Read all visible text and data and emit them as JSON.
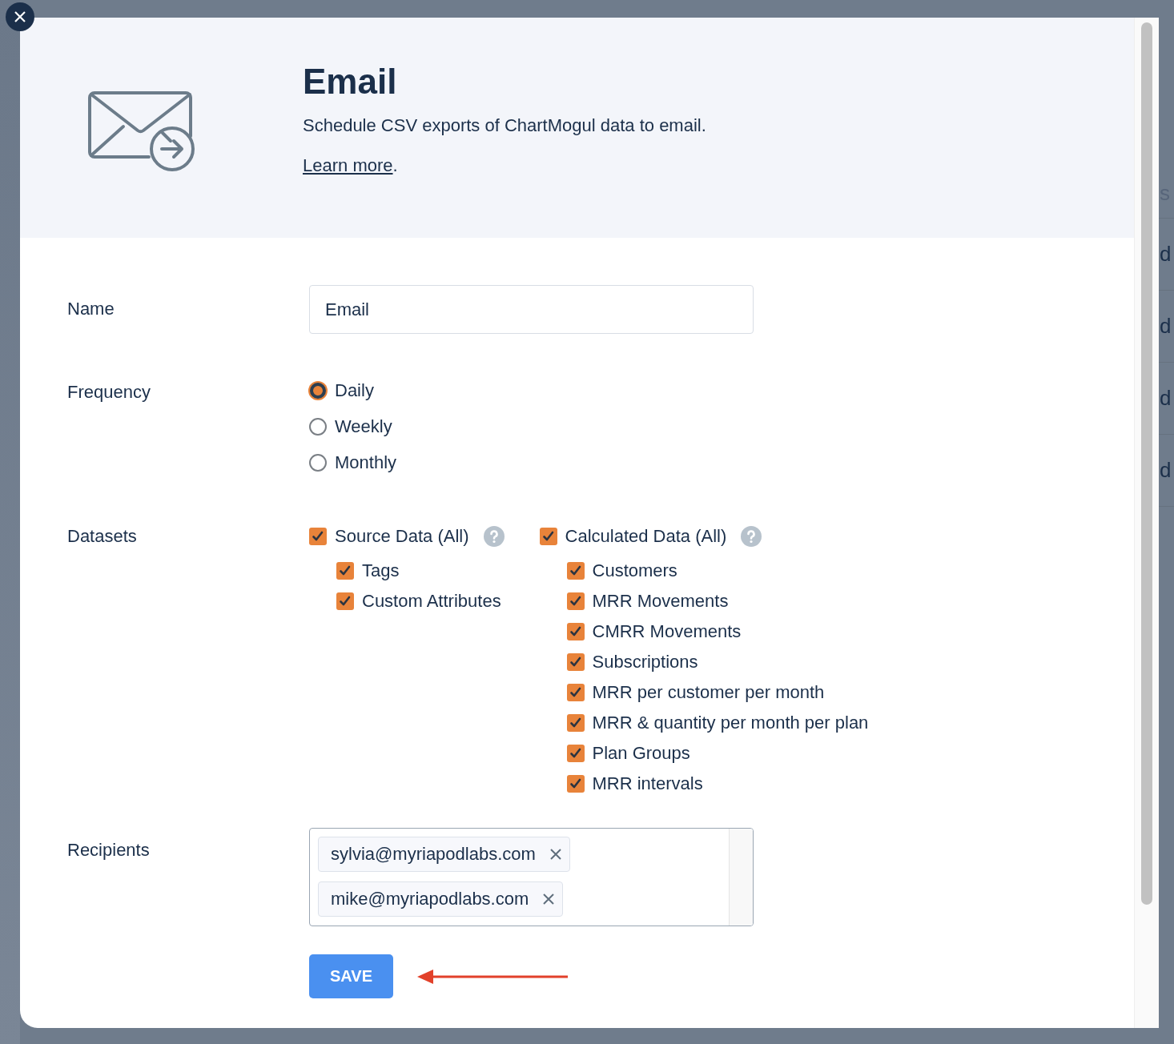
{
  "header": {
    "title": "Email",
    "description": "Schedule CSV exports of ChartMogul data to email.",
    "link": "Learn more",
    "link_suffix": "."
  },
  "name_field": {
    "label": "Name",
    "value": "Email"
  },
  "frequency": {
    "label": "Frequency",
    "options": [
      {
        "label": "Daily",
        "selected": true
      },
      {
        "label": "Weekly",
        "selected": false
      },
      {
        "label": "Monthly",
        "selected": false
      }
    ]
  },
  "datasets": {
    "label": "Datasets",
    "groups": [
      {
        "label": "Source Data (All)",
        "checked": true,
        "children": [
          {
            "label": "Tags",
            "checked": true
          },
          {
            "label": "Custom Attributes",
            "checked": true
          }
        ]
      },
      {
        "label": "Calculated Data (All)",
        "checked": true,
        "children": [
          {
            "label": "Customers",
            "checked": true
          },
          {
            "label": "MRR Movements",
            "checked": true
          },
          {
            "label": "CMRR Movements",
            "checked": true
          },
          {
            "label": "Subscriptions",
            "checked": true
          },
          {
            "label": "MRR per customer per month",
            "checked": true
          },
          {
            "label": "MRR & quantity per month per plan",
            "checked": true
          },
          {
            "label": "Plan Groups",
            "checked": true
          },
          {
            "label": "MRR intervals",
            "checked": true
          }
        ]
      }
    ]
  },
  "recipients": {
    "label": "Recipients",
    "chips": [
      "sylvia@myriapodlabs.com",
      "mike@myriapodlabs.com"
    ]
  },
  "save_button": {
    "label": "SAVE"
  },
  "background_fragments": [
    {
      "text": "s",
      "faded": true
    },
    {
      "text": "d",
      "faded": false
    },
    {
      "text": "d",
      "faded": false
    },
    {
      "text": "d",
      "faded": false
    },
    {
      "text": "d",
      "faded": false
    }
  ]
}
